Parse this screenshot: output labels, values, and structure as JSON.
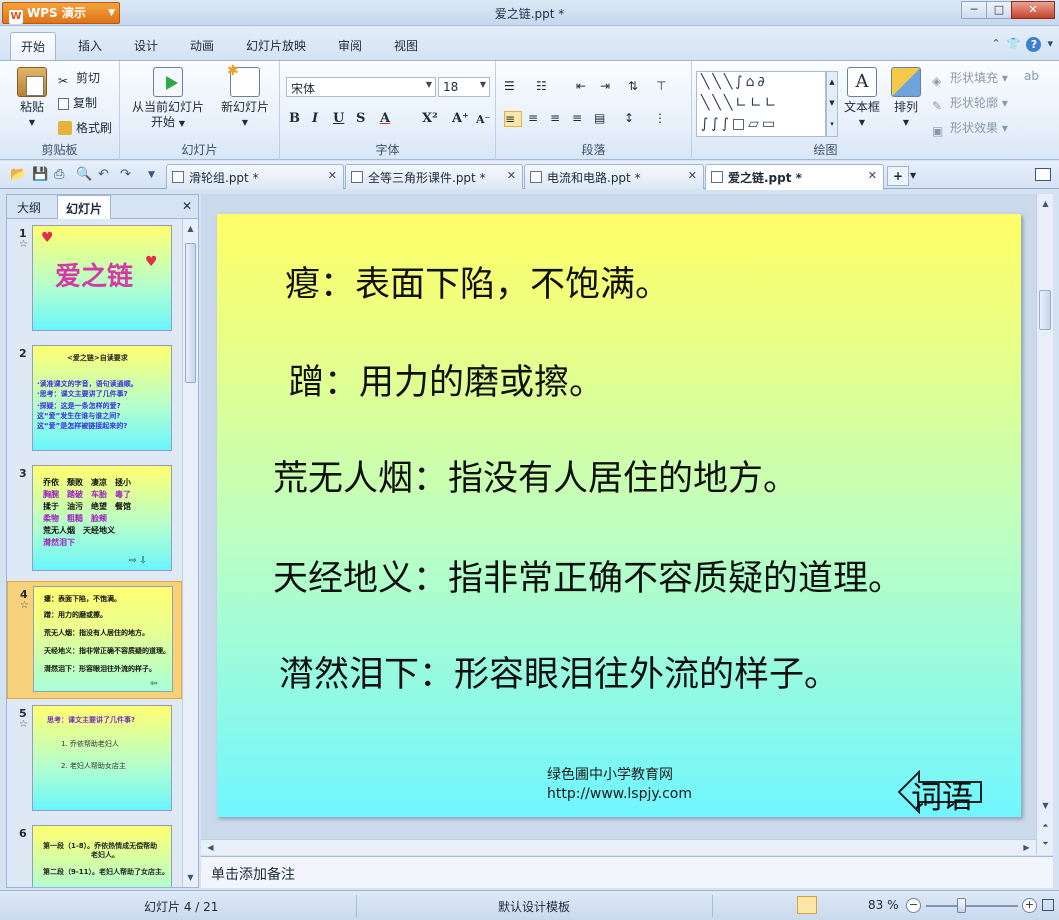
{
  "app": {
    "menu_button": "WPS 演示",
    "window_title": "爱之链.ppt *"
  },
  "menu_tabs": [
    "开始",
    "插入",
    "设计",
    "动画",
    "幻灯片放映",
    "审阅",
    "视图"
  ],
  "ribbon": {
    "clipboard": {
      "paste": "粘贴",
      "cut": "剪切",
      "copy": "复制",
      "format_painter": "格式刷",
      "label": "剪贴板"
    },
    "slides": {
      "from_current_l1": "从当前幻灯片",
      "from_current_l2": "开始",
      "new_slide": "新幻灯片",
      "label": "幻灯片"
    },
    "font": {
      "family": "宋体",
      "size": "18",
      "label": "字体",
      "bold": "B",
      "italic": "I",
      "underline": "U",
      "shadow": "S",
      "color": "A"
    },
    "paragraph": {
      "label": "段落"
    },
    "drawing": {
      "textbox": "文本框",
      "arrange": "排列",
      "shape_fill": "形状填充",
      "shape_outline": "形状轮廓",
      "shape_effects": "形状效果",
      "label": "绘图"
    }
  },
  "doc_tabs": [
    {
      "label": "滑轮组.ppt *",
      "active": false
    },
    {
      "label": "全等三角形课件.ppt *",
      "active": false
    },
    {
      "label": "电流和电路.ppt *",
      "active": false
    },
    {
      "label": "爱之链.ppt *",
      "active": true
    }
  ],
  "side_panel": {
    "tab_outline": "大纲",
    "tab_slides": "幻灯片",
    "thumbnails": [
      {
        "num": "1",
        "title": "爱之链"
      },
      {
        "num": "2",
        "lines": [
          "<爱之链>自读要求",
          "·读准课文的字音，语句读通顺。",
          "·思考：课文主要讲了几件事?",
          "·探疑：这是一条怎样的爱?",
          "  这“爱”发生在谁与谁之间?",
          "  这“爱”是怎样被链接起来的?"
        ]
      },
      {
        "num": "3",
        "lines": [
          "乔依　颓败　凄凉　拯小",
          "胸腕　踏破　车胎　毒了",
          "揉于　油污　绝望　餐馆",
          "柔物　粗糙　脸颊",
          "荒无人烟　天经地义",
          "潸然泪下"
        ]
      },
      {
        "num": "4",
        "lines": [
          "瘪：表面下陷，不饱满。",
          "蹭：用力的磨或擦。",
          "荒无人烟：指没有人居住的地方。",
          "天经地义：指非常正确不容质疑的道理。",
          "潸然泪下：形容眼泪往外流的样子。"
        ]
      },
      {
        "num": "5",
        "lines": [
          "思考：课文主要讲了几件事?",
          "1. 乔依帮助老妇人",
          "2. 老妇人帮助女店主"
        ]
      },
      {
        "num": "6",
        "lines": [
          "第一段（1-8）。乔依热情成无偿帮助",
          "老妇人。",
          "第二段（9-11）。老妇人帮助了女店主。"
        ]
      }
    ]
  },
  "slide": {
    "lines": [
      "瘪：表面下陷，不饱满。",
      "蹭：用力的磨或擦。",
      "荒无人烟：指没有人居住的地方。",
      "天经地义：指非常正确不容质疑的道理。",
      "潸然泪下：形容眼泪往外流的样子。"
    ],
    "footer_line1": "绿色圃中小学教育网",
    "footer_line2": "http://www.lspjy.com",
    "back_button": "词语"
  },
  "notes_placeholder": "单击添加备注",
  "status": {
    "slide_counter": "幻灯片 4 / 21",
    "template": "默认设计模板",
    "zoom": "83 %"
  }
}
